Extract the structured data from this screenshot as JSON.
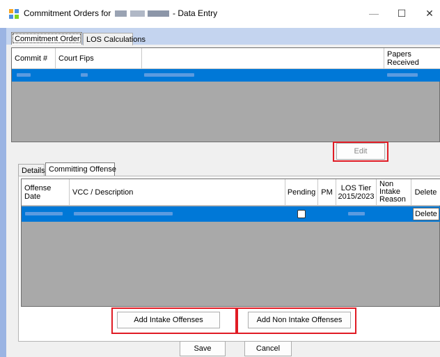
{
  "window": {
    "title_prefix": "Commitment Orders for",
    "title_suffix": "- Data Entry",
    "minimize": "—",
    "maximize": "☐",
    "close": "✕"
  },
  "top_tabs": [
    "Commitment Order",
    "LOS Calculations"
  ],
  "commitment_grid": {
    "columns": [
      "Commit #",
      "Court Fips",
      "",
      "Papers Received"
    ]
  },
  "edit_button": "Edit",
  "lower_tabs": [
    "Details",
    "Committing Offense"
  ],
  "offense_grid": {
    "columns": [
      "Offense Date",
      "VCC / Description",
      "Pending",
      "PM",
      "LOS Tier 2015/2023",
      "Non Intake Reason",
      "Delete"
    ],
    "row_delete_label": "Delete",
    "pending_checked": false
  },
  "buttons": {
    "add_intake": "Add Intake Offenses",
    "add_non_intake": "Add Non Intake Offenses",
    "save": "Save",
    "cancel": "Cancel"
  },
  "colors": {
    "selection": "#0078d7",
    "highlight_box": "#e01b24",
    "tab_strip": "#c4d4ef"
  }
}
